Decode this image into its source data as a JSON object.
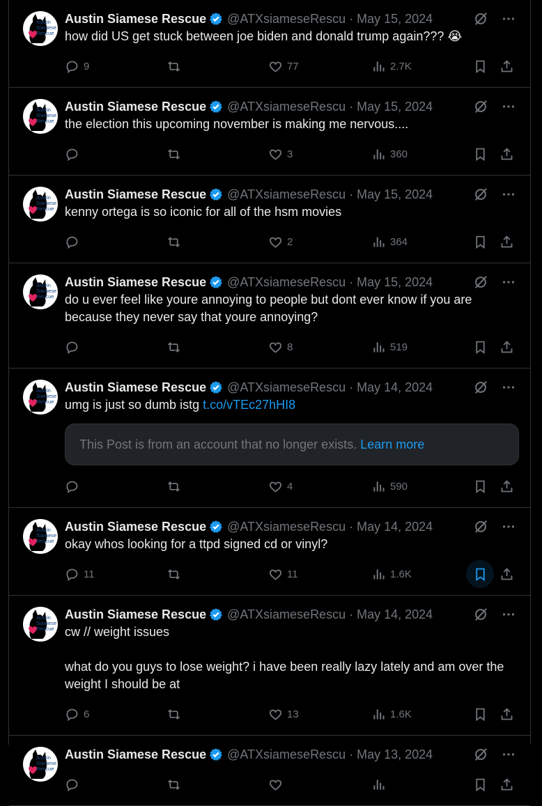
{
  "account": {
    "name": "Austin Siamese Rescue",
    "handle": "@ATXsiameseRescu",
    "avatar_text": [
      "Austin",
      "Siamese",
      "Rescue"
    ],
    "verified_color": "#1d9bf0"
  },
  "separator": "·",
  "colors": {
    "background": "#000000",
    "text": "#e7e9ea",
    "muted": "#71767b",
    "accent": "#1d9bf0",
    "border": "#2f3336"
  },
  "tweets": [
    {
      "date": "May 15, 2024",
      "text": "how did US get stuck between joe biden and donald trump again??? ",
      "emoji": "😭",
      "replies": "9",
      "retweets": "",
      "likes": "77",
      "views": "2.7K"
    },
    {
      "date": "May 15, 2024",
      "text": "the election this upcoming november is making me nervous....",
      "replies": "",
      "retweets": "",
      "likes": "3",
      "views": "360"
    },
    {
      "date": "May 15, 2024",
      "text": "kenny ortega is so iconic for all of the hsm movies",
      "replies": "",
      "retweets": "",
      "likes": "2",
      "views": "364"
    },
    {
      "date": "May 15, 2024",
      "text": "do u ever feel like youre annoying to people but dont ever know if you are because they never say that youre annoying?",
      "replies": "",
      "retweets": "",
      "likes": "8",
      "views": "519"
    },
    {
      "date": "May 14, 2024",
      "text": "umg is just so dumb istg ",
      "link": "t.co/vTEc27hHI8",
      "quote_text": "This Post is from an account that no longer exists.",
      "quote_link": "Learn more",
      "replies": "",
      "retweets": "",
      "likes": "4",
      "views": "590"
    },
    {
      "date": "May 14, 2024",
      "text": "okay whos looking for a ttpd signed cd or vinyl?",
      "replies": "11",
      "retweets": "",
      "likes": "11",
      "views": "1.6K",
      "bookmark_hover": true
    },
    {
      "date": "May 14, 2024",
      "text": "cw // weight issues\n\nwhat do you guys to lose weight? i have been really lazy lately and am over the weight I should be at",
      "replies": "6",
      "retweets": "",
      "likes": "13",
      "views": "1.6K"
    },
    {
      "date": "May 13, 2024",
      "text": "",
      "replies": "",
      "retweets": "",
      "likes": "",
      "views": ""
    }
  ]
}
